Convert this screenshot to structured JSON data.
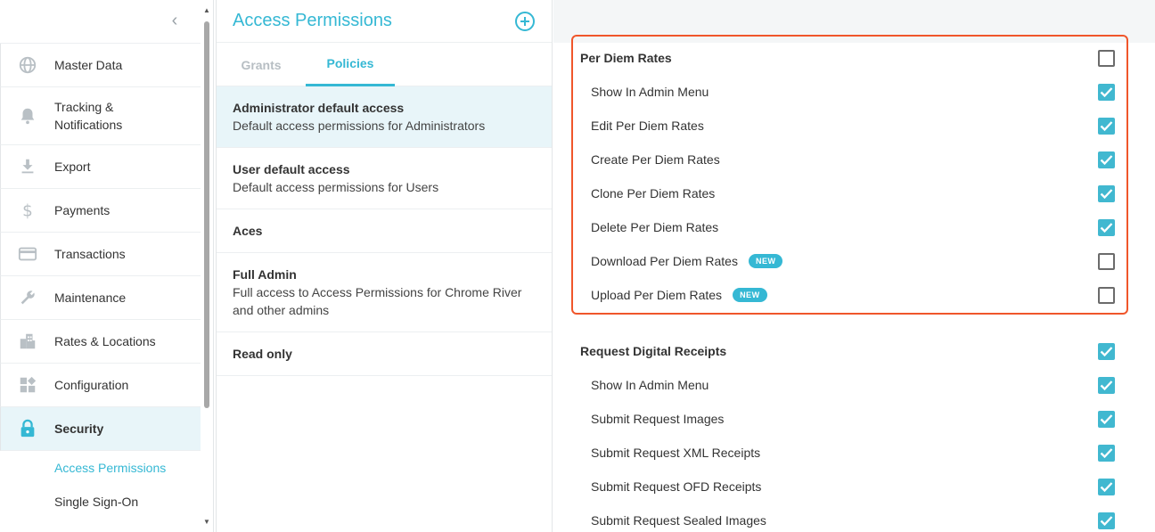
{
  "sidebar": {
    "items": [
      {
        "label": "Master Data",
        "icon": "globe-icon"
      },
      {
        "label": "Tracking &\nNotifications",
        "icon": "bell-icon"
      },
      {
        "label": "Export",
        "icon": "download-icon"
      },
      {
        "label": "Payments",
        "icon": "dollar-icon"
      },
      {
        "label": "Transactions",
        "icon": "credit-card-icon"
      },
      {
        "label": "Maintenance",
        "icon": "wrench-icon"
      },
      {
        "label": "Rates & Locations",
        "icon": "city-icon"
      },
      {
        "label": "Configuration",
        "icon": "widgets-icon"
      },
      {
        "label": "Security",
        "icon": "lock-icon"
      }
    ],
    "subitems": [
      {
        "label": "Access Permissions"
      },
      {
        "label": "Single Sign-On"
      }
    ]
  },
  "middle": {
    "title": "Access Permissions",
    "tabs": [
      {
        "label": "Grants"
      },
      {
        "label": "Policies"
      }
    ],
    "policies": [
      {
        "name": "Administrator default access",
        "desc": "Default access permissions for Administrators"
      },
      {
        "name": "User default access",
        "desc": "Default access permissions for Users"
      },
      {
        "name": "Aces",
        "desc": ""
      },
      {
        "name": "Full Admin",
        "desc": "Full access to Access Permissions for Chrome River and other admins"
      },
      {
        "name": "Read only",
        "desc": ""
      }
    ]
  },
  "permissions": {
    "new_badge": "NEW",
    "per_diem": {
      "header": {
        "label": "Per Diem Rates",
        "checked": false
      },
      "rows": [
        {
          "label": "Show In Admin Menu",
          "checked": true
        },
        {
          "label": "Edit Per Diem Rates",
          "checked": true
        },
        {
          "label": "Create Per Diem Rates",
          "checked": true
        },
        {
          "label": "Clone Per Diem Rates",
          "checked": true
        },
        {
          "label": "Delete Per Diem Rates",
          "checked": true
        },
        {
          "label": "Download Per Diem Rates",
          "checked": false,
          "new": true
        },
        {
          "label": "Upload Per Diem Rates",
          "checked": false,
          "new": true
        }
      ]
    },
    "digital_receipts": {
      "header": {
        "label": "Request Digital Receipts",
        "checked": true
      },
      "rows": [
        {
          "label": "Show In Admin Menu",
          "checked": true
        },
        {
          "label": "Submit Request Images",
          "checked": true
        },
        {
          "label": "Submit Request XML Receipts",
          "checked": true
        },
        {
          "label": "Submit Request OFD Receipts",
          "checked": true
        },
        {
          "label": "Submit Request Sealed Images",
          "checked": true
        }
      ]
    }
  },
  "colors": {
    "accent": "#35b8d4",
    "checkbox": "#41b8d0",
    "highlight": "#f0562b",
    "selected_bg": "#e8f5f9"
  }
}
